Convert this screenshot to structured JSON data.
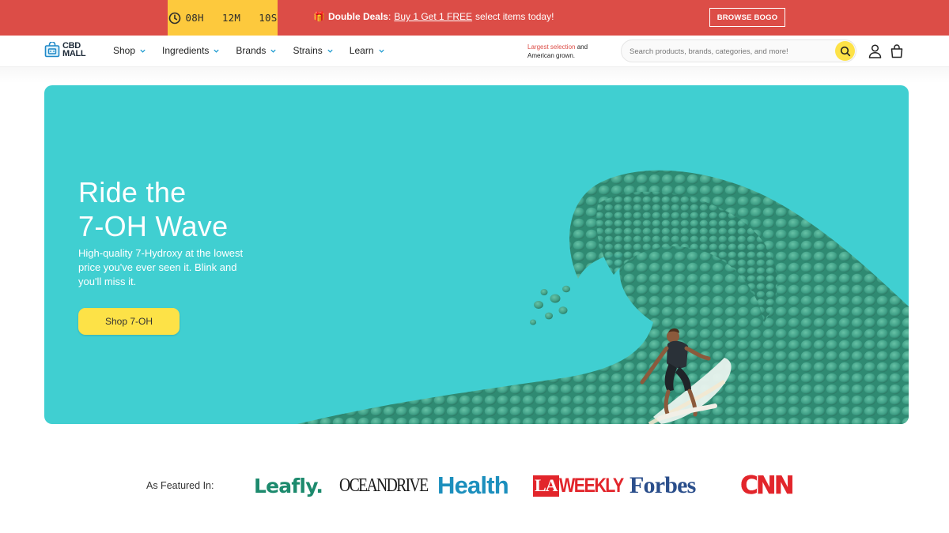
{
  "promo": {
    "timer": "08H   12M   10S",
    "deal_title": "Double Deals",
    "deal_separator": ":",
    "deal_link": "Buy 1 Get 1 FREE",
    "deal_text": "select items today!",
    "bogo_button": "BROWSE BOGO"
  },
  "header": {
    "logo_line1": "CBD",
    "logo_line2": "MALL",
    "nav": [
      {
        "label": "Shop"
      },
      {
        "label": "Ingredients"
      },
      {
        "label": "Brands"
      },
      {
        "label": "Strains"
      },
      {
        "label": "Learn"
      }
    ],
    "selection_red": "Largest selection",
    "selection_rest": " and",
    "selection_line2": "American grown.",
    "search_placeholder": "Search products, brands, categories, and more!"
  },
  "hero": {
    "title_line1": "Ride the",
    "title_line2": "7-OH Wave",
    "subtitle": "High-quality 7-Hydroxy at the lowest price you've ever seen it. Blink and you'll miss it.",
    "button": "Shop 7-OH"
  },
  "featured": {
    "label": "As Featured In:",
    "logos": [
      "Leafly.",
      "OCEANDRIVE",
      "Health",
      "LA",
      "WEEKLY",
      "Forbes",
      "CNN"
    ]
  },
  "colors": {
    "promo_bg": "#dc4d47",
    "timer_bg": "#fdc93d",
    "hero_bg": "#40cfd1",
    "accent_yellow": "#fde247",
    "wave_green": "#3f9f86"
  }
}
